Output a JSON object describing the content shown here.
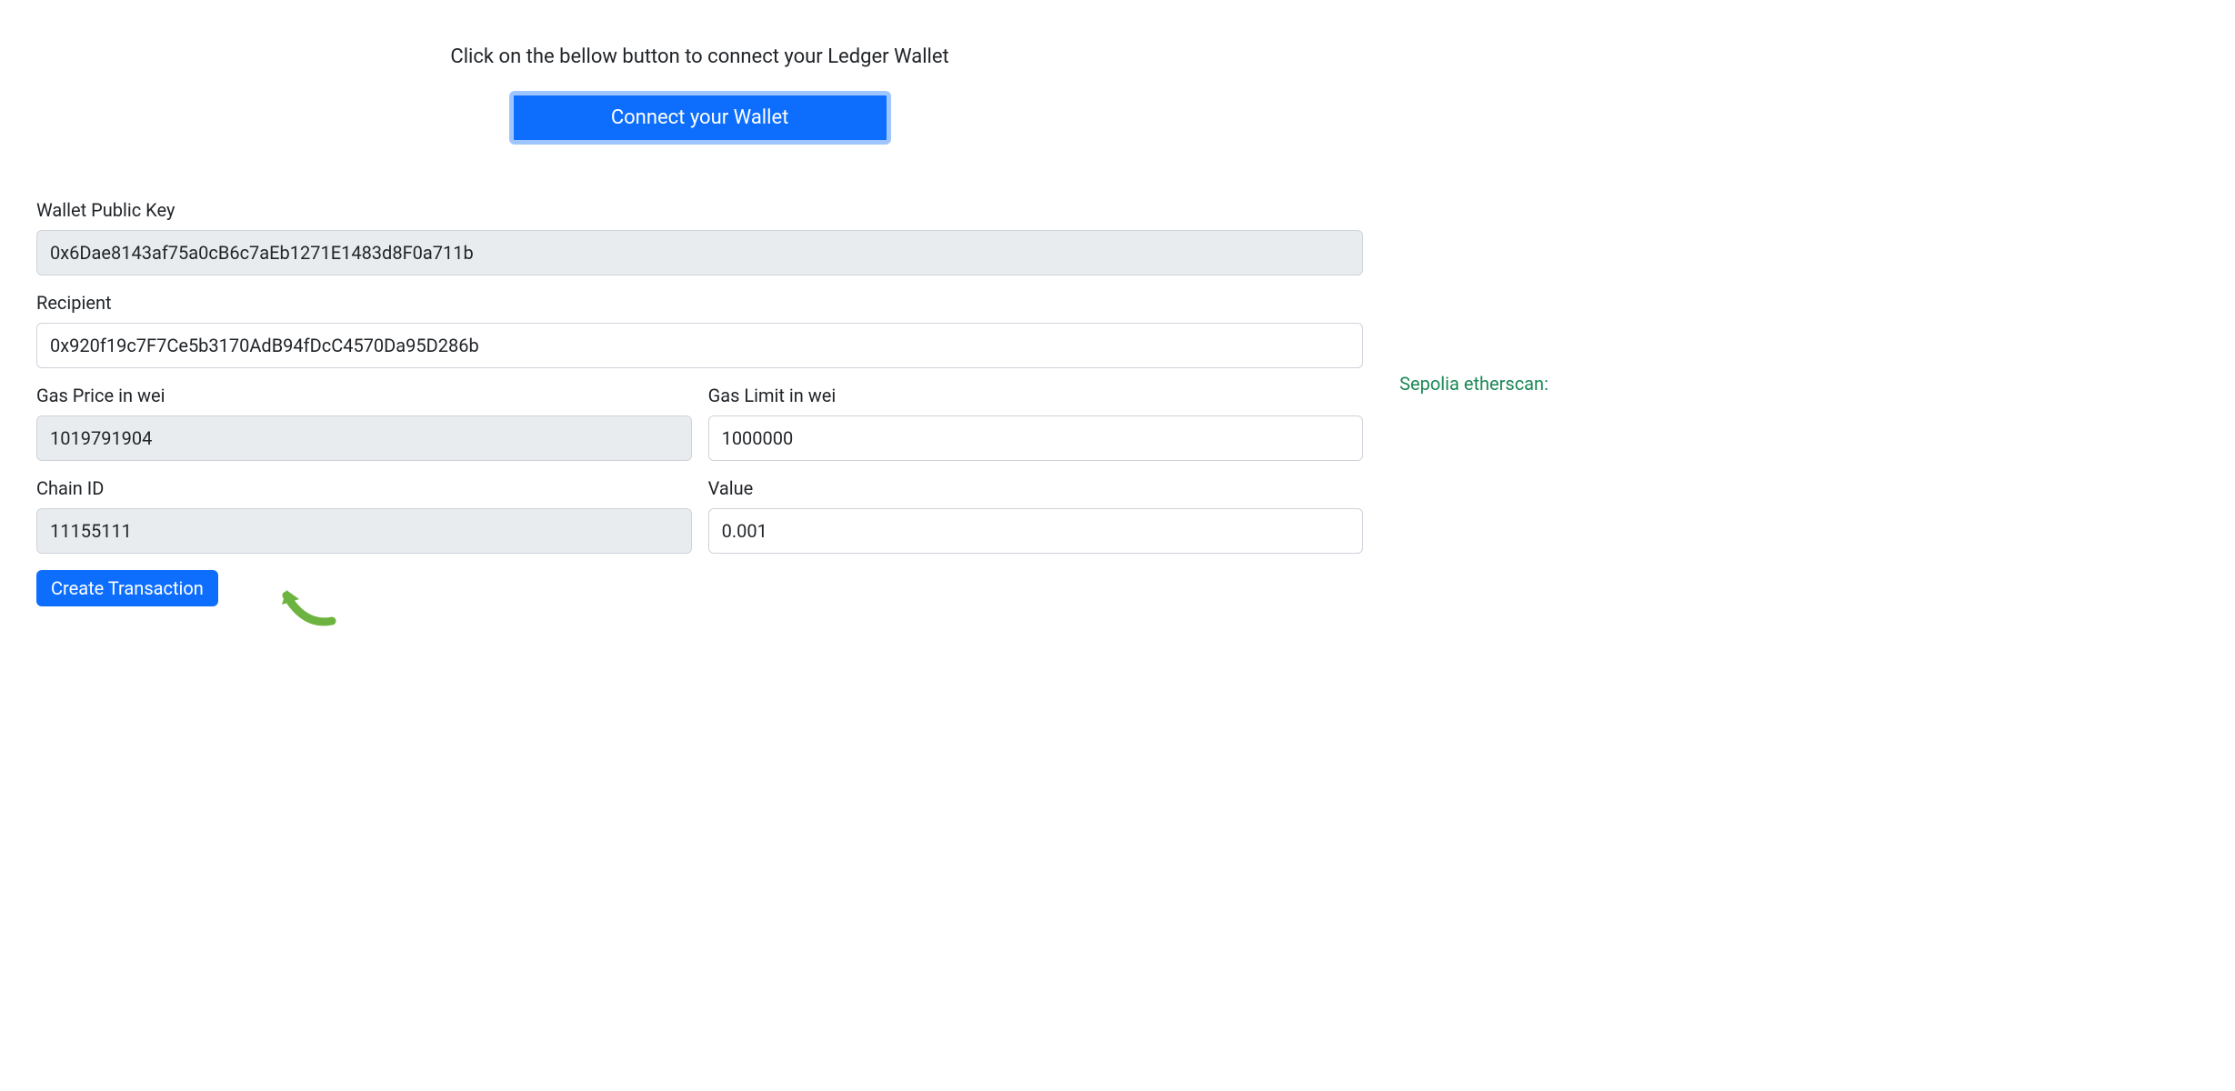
{
  "header": {
    "instruction": "Click on the bellow button to connect your Ledger Wallet",
    "connect_button_label": "Connect your Wallet"
  },
  "form": {
    "wallet_public_key": {
      "label": "Wallet Public Key",
      "value": "0x6Dae8143af75a0cB6c7aEb1271E1483d8F0a711b"
    },
    "recipient": {
      "label": "Recipient",
      "value": "0x920f19c7F7Ce5b3170AdB94fDcC4570Da95D286b"
    },
    "gas_price": {
      "label": "Gas Price in wei",
      "value": "1019791904"
    },
    "gas_limit": {
      "label": "Gas Limit in wei",
      "value": "1000000"
    },
    "chain_id": {
      "label": "Chain ID",
      "value": "11155111"
    },
    "tx_value": {
      "label": "Value",
      "value": "0.001"
    },
    "create_button_label": "Create Transaction"
  },
  "sidebar": {
    "etherscan_label": "Sepolia etherscan:"
  }
}
